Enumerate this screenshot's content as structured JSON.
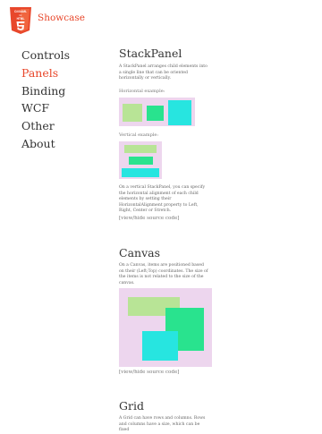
{
  "header": {
    "logo_text": "C# / XAML for HTML5",
    "app_title": "Showcase"
  },
  "nav": {
    "items": [
      {
        "label": "Controls",
        "active": false
      },
      {
        "label": "Panels",
        "active": true
      },
      {
        "label": "Binding",
        "active": false
      },
      {
        "label": "WCF",
        "active": false
      },
      {
        "label": "Other",
        "active": false
      },
      {
        "label": "About",
        "active": false
      }
    ]
  },
  "colors": {
    "accent": "#e8472b",
    "demo_background": "#edd6ee",
    "light_green": "#b8e496",
    "green": "#29e38e",
    "cyan": "#27e5e0"
  },
  "stackpanel": {
    "title": "StackPanel",
    "description": "A StackPanel arranges child elements into a single line that can be oriented horizontally or vertically.",
    "horizontal_label": "Horizontal example:",
    "vertical_label": "Vertical example:",
    "alignment_text": "On a vertical StackPanel, you can specify the horizontal alignment of each child elements by setting their HorizontalAlignment property to Left, Right, Center or Stretch.",
    "source_link": "[view/hide source code]"
  },
  "canvas": {
    "title": "Canvas",
    "description": "On a Canvas, items are positioned based on their (Left;Top) coordinates. The size of the items is not related to the size of the canvas.",
    "source_link": "[view/hide source code]"
  },
  "grid": {
    "title": "Grid",
    "description": "A Grid can have rows and columns. Rows and columns have a size, which can be fixed"
  }
}
